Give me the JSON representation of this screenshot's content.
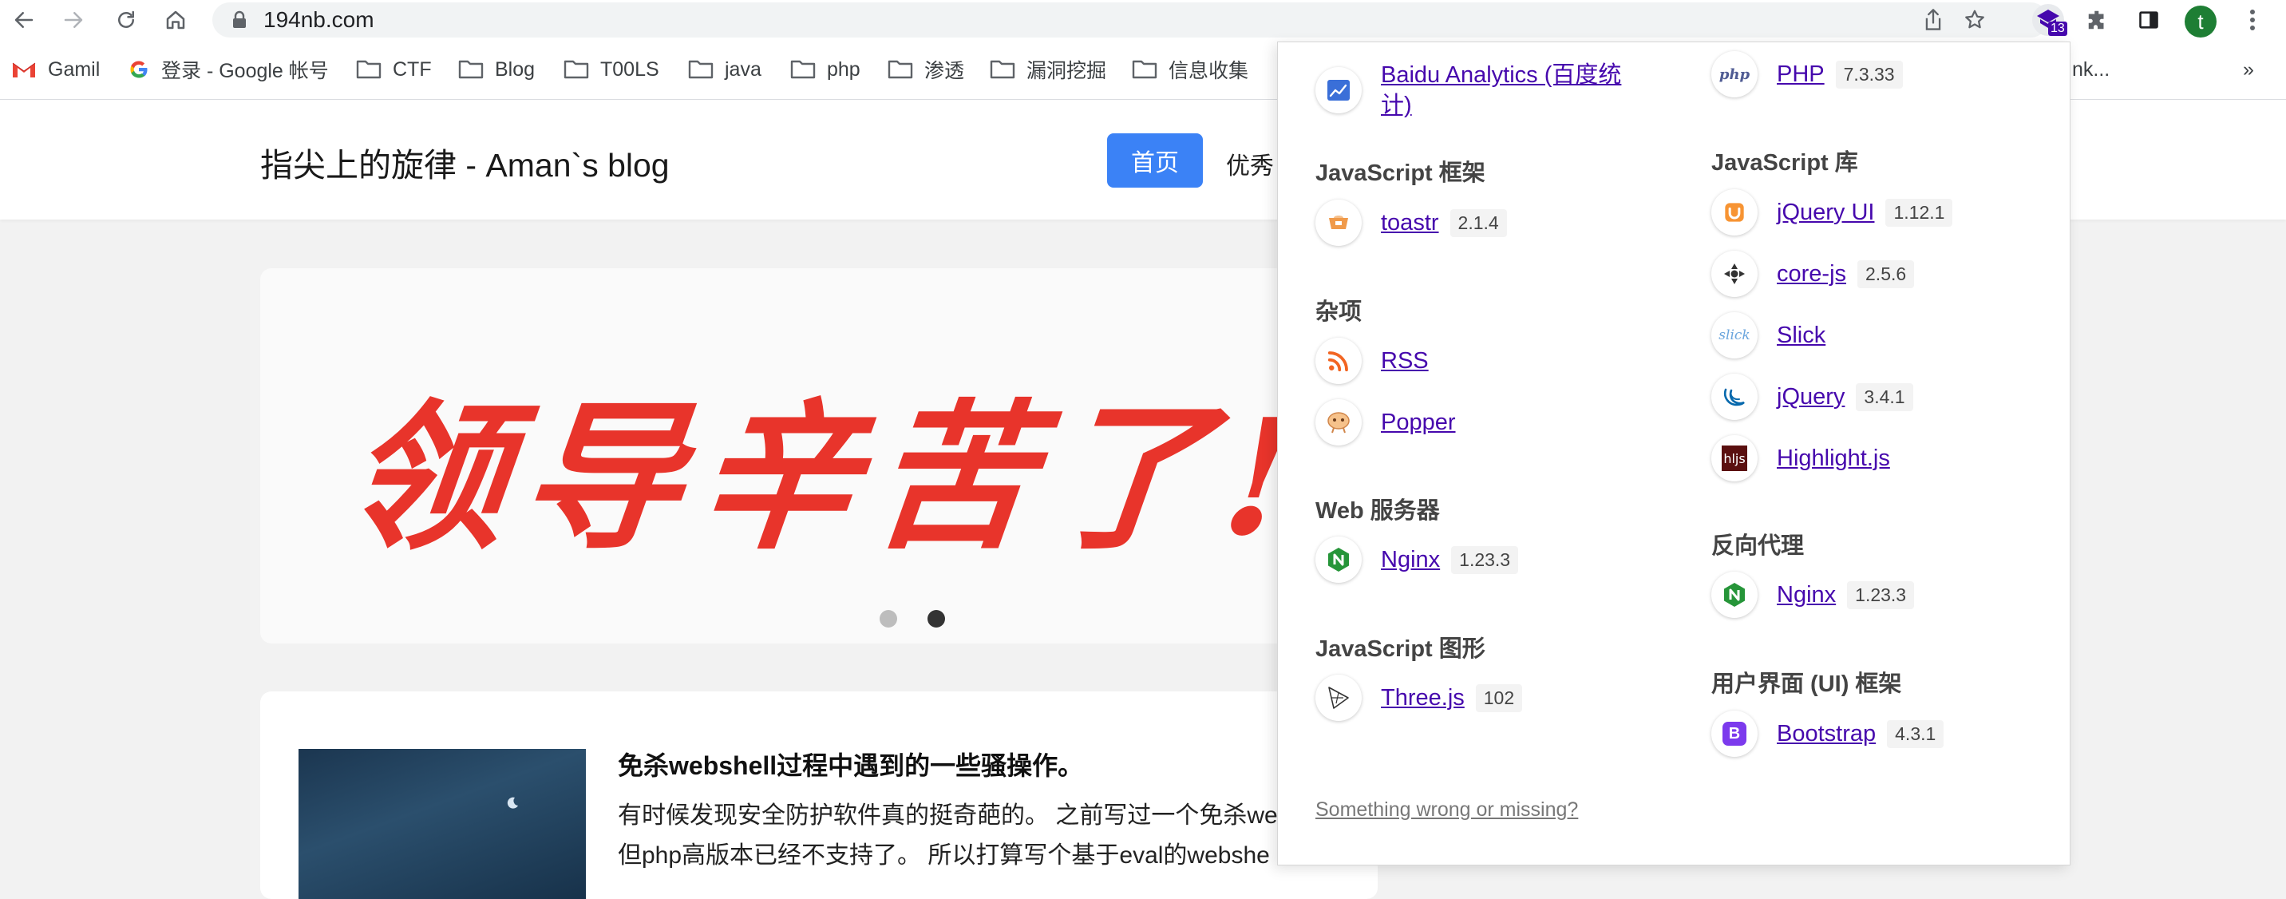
{
  "browser": {
    "url": "194nb.com",
    "profile_initial": "t",
    "extension_badge": "13",
    "bookmarks": [
      {
        "label": "Gamil",
        "icon": "gmail-icon"
      },
      {
        "label": "登录 - Google 帐号",
        "icon": "google-icon"
      },
      {
        "label": "CTF",
        "icon": "folder-icon"
      },
      {
        "label": "Blog",
        "icon": "folder-icon"
      },
      {
        "label": "T00LS",
        "icon": "folder-icon"
      },
      {
        "label": "java",
        "icon": "folder-icon"
      },
      {
        "label": "php",
        "icon": "folder-icon"
      },
      {
        "label": "渗透",
        "icon": "folder-icon"
      },
      {
        "label": "漏洞挖掘",
        "icon": "folder-icon"
      },
      {
        "label": "信息收集",
        "icon": "folder-icon"
      },
      {
        "label": "nk...",
        "icon": "bookmark-icon"
      }
    ],
    "bookmarks_overflow": "»"
  },
  "page": {
    "site_title": "指尖上的旋律 - Aman`s blog",
    "nav_home": "首页",
    "nav_next": "优秀",
    "banner_text": "领导辛苦了!",
    "post": {
      "title": "免杀webshell过程中遇到的一些骚操作。",
      "line1": "有时候发现安全防护软件真的挺奇葩的。 之前写过一个免杀we",
      "line2": "但php高版本已经不支持了。 所以打算写个基于eval的webshe"
    }
  },
  "popup": {
    "left": [
      {
        "type": "tech",
        "name": "Baidu Analytics (百度统",
        "name2": "计)",
        "icon": "baidu-analytics-icon"
      },
      {
        "type": "category",
        "label": "JavaScript 框架"
      },
      {
        "type": "tech",
        "name": "toastr",
        "version": "2.1.4",
        "icon": "toastr-icon"
      },
      {
        "type": "category",
        "label": "杂项"
      },
      {
        "type": "tech",
        "name": "RSS",
        "icon": "rss-icon"
      },
      {
        "type": "tech",
        "name": "Popper",
        "icon": "popper-icon"
      },
      {
        "type": "category",
        "label": "Web 服务器"
      },
      {
        "type": "tech",
        "name": "Nginx",
        "version": "1.23.3",
        "icon": "nginx-icon"
      },
      {
        "type": "category",
        "label": "JavaScript 图形"
      },
      {
        "type": "tech",
        "name": "Three.js",
        "version": "102",
        "icon": "threejs-icon"
      }
    ],
    "right": [
      {
        "type": "tech",
        "name": "PHP",
        "version": "7.3.33",
        "icon": "php-icon"
      },
      {
        "type": "category",
        "label": "JavaScript 库"
      },
      {
        "type": "tech",
        "name": "jQuery UI",
        "version": "1.12.1",
        "icon": "jquery-ui-icon"
      },
      {
        "type": "tech",
        "name": "core-js",
        "version": "2.5.6",
        "icon": "core-js-icon"
      },
      {
        "type": "tech",
        "name": "Slick",
        "icon": "slick-icon"
      },
      {
        "type": "tech",
        "name": "jQuery",
        "version": "3.4.1",
        "icon": "jquery-icon"
      },
      {
        "type": "tech",
        "name": "Highlight.js",
        "icon": "highlightjs-icon"
      },
      {
        "type": "category",
        "label": "反向代理"
      },
      {
        "type": "tech",
        "name": "Nginx",
        "version": "1.23.3",
        "icon": "nginx-icon"
      },
      {
        "type": "category",
        "label": "用户界面 (UI) 框架"
      },
      {
        "type": "tech",
        "name": "Bootstrap",
        "version": "4.3.1",
        "icon": "bootstrap-icon"
      }
    ],
    "footer": "Something wrong or missing?"
  },
  "colors": {
    "accent_blue": "#3b82f6",
    "banner_red": "#e8342b",
    "link_purple": "#4608ad"
  }
}
